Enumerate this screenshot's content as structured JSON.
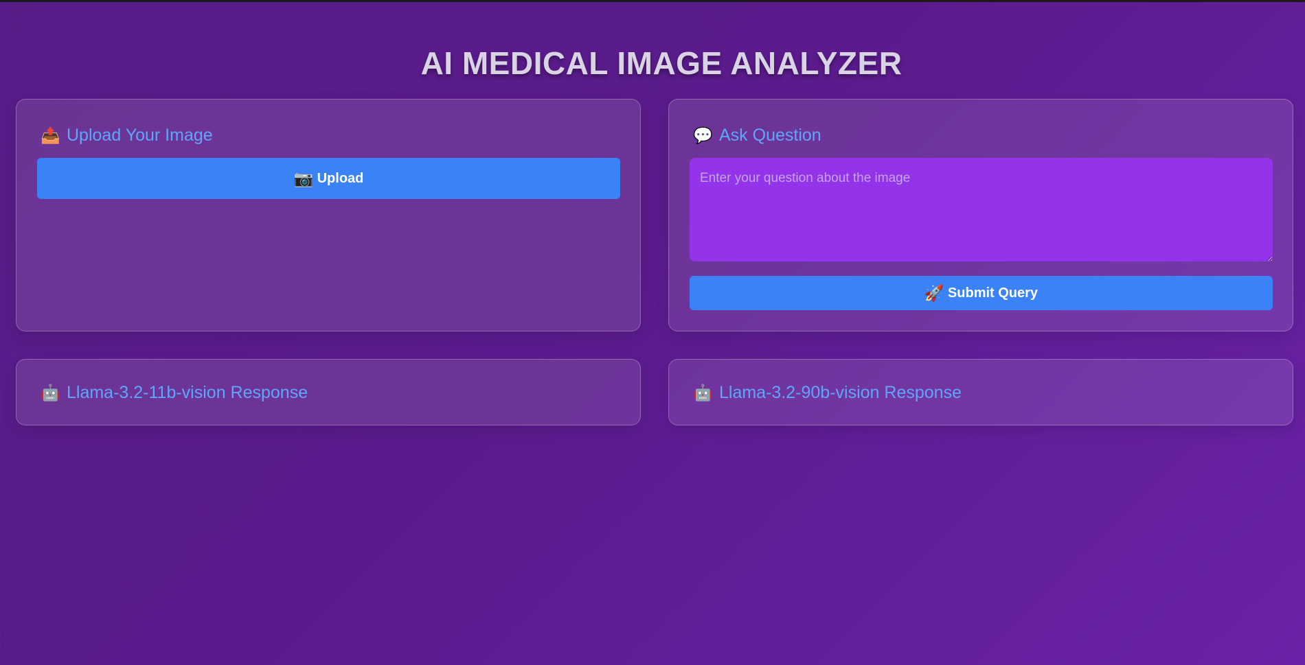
{
  "app": {
    "title": "AI MEDICAL IMAGE ANALYZER"
  },
  "upload_panel": {
    "heading": "Upload Your Image",
    "heading_icon": "📤",
    "button_label": "Upload",
    "button_icon": "📷"
  },
  "ask_panel": {
    "heading": "Ask Question",
    "heading_icon": "💬",
    "question_value": "",
    "question_placeholder": "Enter your question about the image",
    "submit_label": "Submit Query",
    "submit_icon": "🚀"
  },
  "responses": [
    {
      "heading": "Llama-3.2-11b-vision Response",
      "icon": "🤖"
    },
    {
      "heading": "Llama-3.2-90b-vision Response",
      "icon": "🤖"
    }
  ],
  "colors": {
    "background": "#5b1b8c",
    "heading_accent": "#60a5fa",
    "button": "#3b82f6",
    "textarea": "#9333ea"
  }
}
